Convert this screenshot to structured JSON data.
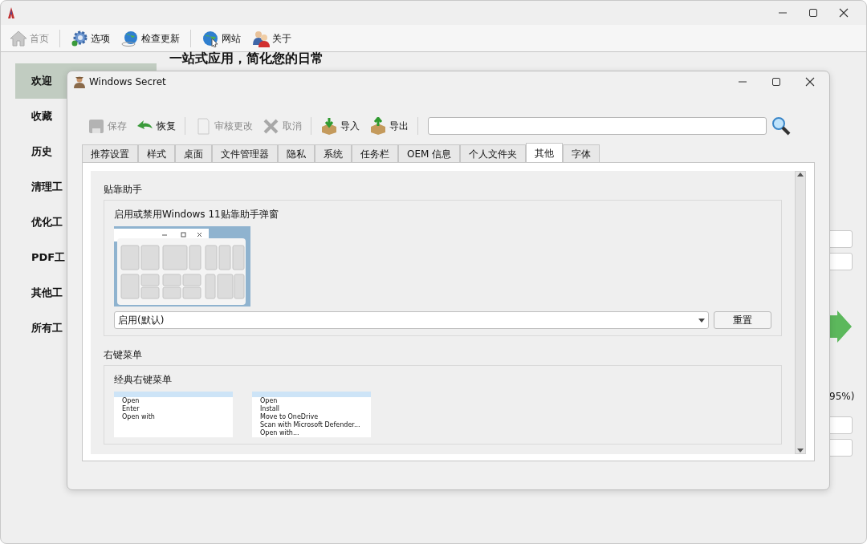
{
  "main_toolbar": [
    {
      "label": "首页",
      "disabled": true
    },
    {
      "label": "选项",
      "disabled": false
    },
    {
      "label": "检查更新",
      "disabled": false
    },
    {
      "label": "网站",
      "disabled": false
    },
    {
      "label": "关于",
      "disabled": false
    }
  ],
  "sidebar": {
    "items": [
      {
        "label": "欢迎",
        "selected": true
      },
      {
        "label": "收藏",
        "selected": false
      },
      {
        "label": "历史",
        "selected": false
      },
      {
        "label": "清理工",
        "selected": false
      },
      {
        "label": "优化工",
        "selected": false
      },
      {
        "label": "PDF工",
        "selected": false
      },
      {
        "label": "其他工",
        "selected": false
      },
      {
        "label": "所有工",
        "selected": false
      }
    ]
  },
  "heading": "一站式应用，简化您的日常",
  "background_text": "95%)",
  "dialog": {
    "title": "Windows Secret",
    "toolbar": [
      {
        "label": "保存",
        "disabled": true
      },
      {
        "label": "恢复",
        "disabled": false
      },
      {
        "label": "审核更改",
        "disabled": true
      },
      {
        "label": "取消",
        "disabled": true
      },
      {
        "label": "导入",
        "disabled": false
      },
      {
        "label": "导出",
        "disabled": false
      }
    ],
    "tabs": [
      {
        "label": "推荐设置",
        "selected": false
      },
      {
        "label": "样式",
        "selected": false
      },
      {
        "label": "桌面",
        "selected": false
      },
      {
        "label": "文件管理器",
        "selected": false
      },
      {
        "label": "隐私",
        "selected": false
      },
      {
        "label": "系统",
        "selected": false
      },
      {
        "label": "任务栏",
        "selected": false
      },
      {
        "label": "OEM 信息",
        "selected": false
      },
      {
        "label": "个人文件夹",
        "selected": false
      },
      {
        "label": "其他",
        "selected": true
      },
      {
        "label": "字体",
        "selected": false
      }
    ],
    "sections": [
      {
        "title": "贴靠助手",
        "kind": "select",
        "option": "启用或禁用Windows 11贴靠助手弹窗",
        "value": "启用(默认)",
        "button": "重置"
      },
      {
        "title": "右键菜单",
        "kind": "previews",
        "option": "经典右键菜单",
        "previews": [
          [
            "Open",
            "Enter",
            "Open with"
          ],
          [
            "Open",
            "Install",
            "Move to OneDrive",
            "Scan with Microsoft Defender...",
            "Open with..."
          ]
        ]
      }
    ]
  }
}
